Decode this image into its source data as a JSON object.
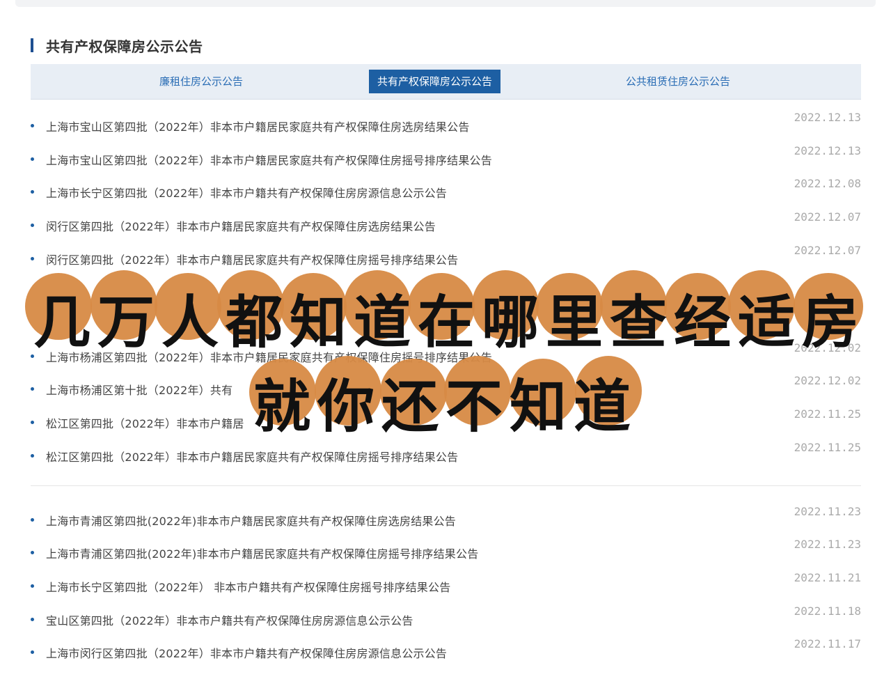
{
  "section": {
    "title": "共有产权保障房公示公告"
  },
  "tabs": [
    {
      "label": "廉租住房公示公告"
    },
    {
      "label": "共有产权保障房公示公告"
    },
    {
      "label": "公共租赁住房公示公告"
    }
  ],
  "list1": [
    {
      "title": "上海市宝山区第四批（2022年）非本市户籍居民家庭共有产权保障住房选房结果公告",
      "date": "2022.12.13"
    },
    {
      "title": "上海市宝山区第四批（2022年）非本市户籍居民家庭共有产权保障住房摇号排序结果公告",
      "date": "2022.12.13"
    },
    {
      "title": "上海市长宁区第四批（2022年）非本市户籍共有产权保障住房房源信息公示公告",
      "date": "2022.12.08"
    },
    {
      "title": "闵行区第四批（2022年）非本市户籍居民家庭共有产权保障住房选房结果公告",
      "date": "2022.12.07"
    },
    {
      "title": "闵行区第四批（2022年）非本市户籍居民家庭共有产权保障住房摇号排序结果公告",
      "date": "2022.12.07"
    },
    {
      "title": "上海市杨浦区第四批（2022年）非本市户籍居民家庭共有产权保障住房摇号排序结果公告",
      "date": "2022.12.02"
    },
    {
      "title": "上海市杨浦区第十批（2022年）共有",
      "date": "2022.12.02"
    },
    {
      "title": "松江区第四批（2022年）非本市户籍居",
      "date": "2022.11.25"
    },
    {
      "title": "松江区第四批（2022年）非本市户籍居民家庭共有产权保障住房摇号排序结果公告",
      "date": "2022.11.25"
    }
  ],
  "list2": [
    {
      "title": "上海市青浦区第四批(2022年)非本市户籍居民家庭共有产权保障住房选房结果公告",
      "date": "2022.11.23"
    },
    {
      "title": "上海市青浦区第四批(2022年)非本市户籍居民家庭共有产权保障住房摇号排序结果公告",
      "date": "2022.11.23"
    },
    {
      "title": "上海市长宁区第四批（2022年） 非本市户籍共有产权保障住房摇号排序结果公告",
      "date": "2022.11.21"
    },
    {
      "title": "宝山区第四批（2022年）非本市户籍共有产权保障住房房源信息公示公告",
      "date": "2022.11.18"
    },
    {
      "title": "上海市闵行区第四批（2022年）非本市户籍共有产权保障住房房源信息公示公告",
      "date": "2022.11.17"
    }
  ],
  "overlay": {
    "line1": "几万人都知道在哪里查经适房",
    "line2": "就你还不知道",
    "blob_color": "#d78a45"
  }
}
